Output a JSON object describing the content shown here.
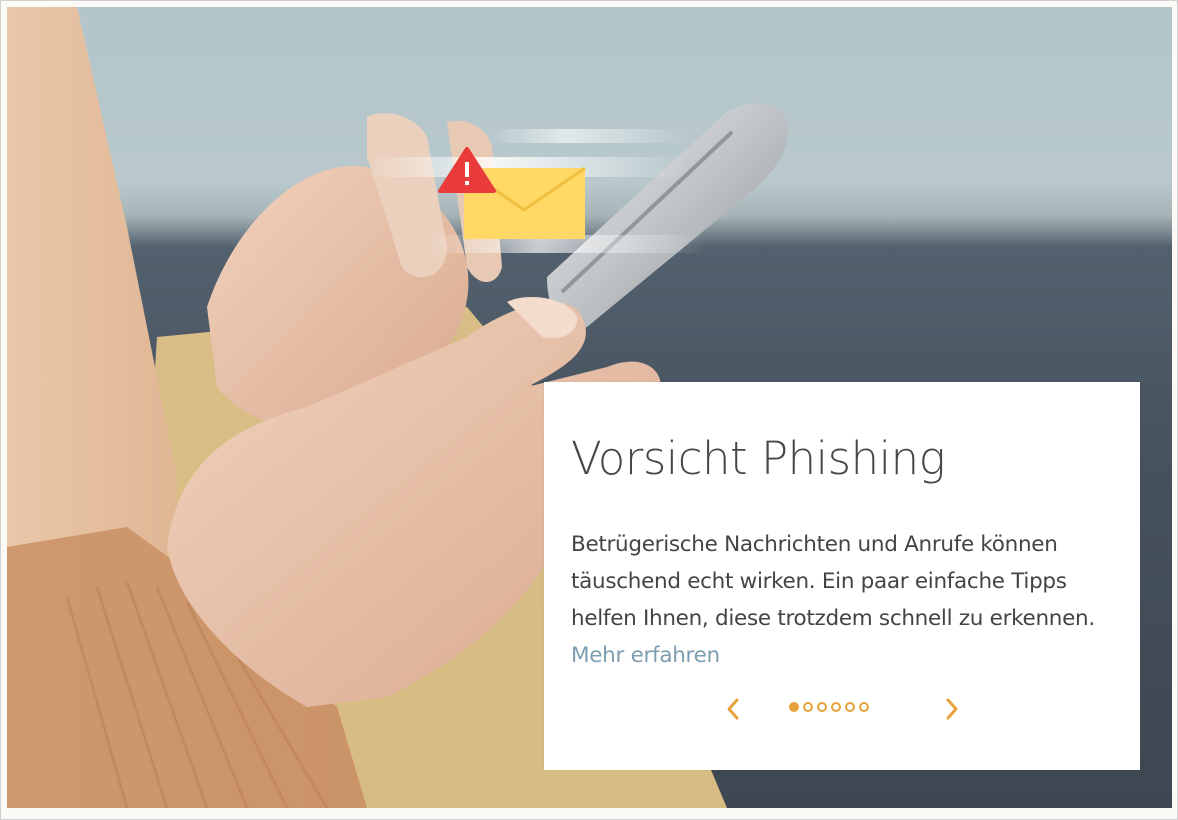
{
  "slide": {
    "title": "Vorsicht Phishing",
    "text": "Betrügerische Nachrichten und Anrufe können täuschend echt wirken. Ein paar einfache Tipps helfen Ihnen, diese trotzdem schnell zu erkennen.",
    "link_label": "Mehr erfahren"
  },
  "carousel": {
    "slide_count": 6,
    "active_index": 0,
    "prev_icon": "chevron-left-icon",
    "next_icon": "chevron-right-icon"
  },
  "colors": {
    "accent": "#e8a23a",
    "link": "#7d9db1",
    "warning": "#e83a3a",
    "envelope": "#ffd866"
  }
}
